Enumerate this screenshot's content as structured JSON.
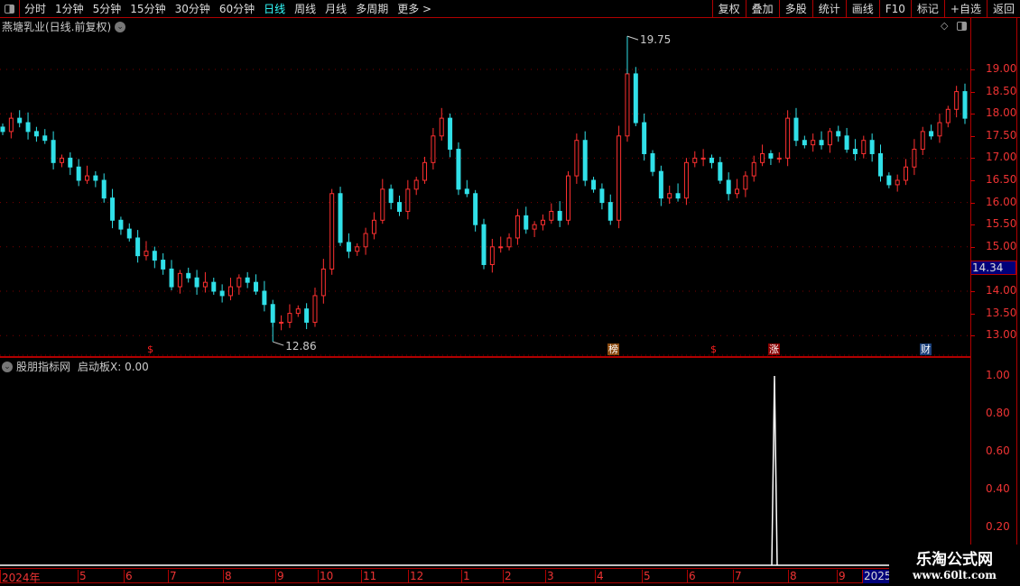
{
  "toolbar": {
    "periods": [
      "分时",
      "1分钟",
      "5分钟",
      "15分钟",
      "30分钟",
      "60分钟",
      "日线",
      "周线",
      "月线",
      "多周期",
      "更多 >"
    ],
    "active_period": "日线",
    "buttons": [
      "复权",
      "叠加",
      "多股",
      "统计",
      "画线",
      "F10",
      "标记",
      "+自选",
      "返回"
    ]
  },
  "title": "燕塘乳业(日线.前复权)",
  "price_axis": {
    "labels": [
      "19.00",
      "18.50",
      "18.00",
      "17.50",
      "17.00",
      "16.50",
      "16.00",
      "15.50",
      "15.00",
      "14.00",
      "13.50",
      "13.00"
    ],
    "current_price": "14.34"
  },
  "annotations": {
    "max_label": "19.75",
    "min_label": "12.86"
  },
  "event_tags": [
    {
      "text": "$",
      "color": "#ff2020",
      "bg": ""
    },
    {
      "text": "榜",
      "color": "#fff",
      "bg": "#8a4a10"
    },
    {
      "text": "$",
      "color": "#ff2020",
      "bg": ""
    },
    {
      "text": "涨",
      "color": "#fff",
      "bg": "#8a0000"
    },
    {
      "text": "财",
      "color": "#fff",
      "bg": "#1a3f7a"
    }
  ],
  "indicator": {
    "title": "股朋指标网",
    "name": "启动板X: 0.00",
    "axis_labels": [
      "1.00",
      "0.80",
      "0.60",
      "0.40",
      "0.20"
    ],
    "spike_value": 1.0
  },
  "time_axis": [
    "2024年",
    "5",
    "6",
    "7",
    "8",
    "9",
    "10",
    "11",
    "12",
    "1",
    "2",
    "3",
    "4",
    "5",
    "6",
    "7",
    "8",
    "9",
    "2025"
  ],
  "watermark": {
    "line1": "乐淘公式网",
    "line2": "www.60lt.com"
  },
  "colors": {
    "up": "#ff3030",
    "down": "#30e0e8",
    "axis": "#b00000",
    "accent": "#33ffff"
  },
  "chart_data": {
    "type": "candlestick",
    "ylim": [
      12.7,
      20.0
    ],
    "closes": [
      17.6,
      17.9,
      17.8,
      17.6,
      17.5,
      17.4,
      16.9,
      17.0,
      16.8,
      16.5,
      16.6,
      16.5,
      16.1,
      15.6,
      15.4,
      15.2,
      14.8,
      14.9,
      14.7,
      14.5,
      14.1,
      14.4,
      14.3,
      14.1,
      14.2,
      14.0,
      13.9,
      14.1,
      14.3,
      14.2,
      14.0,
      13.7,
      13.3,
      13.3,
      13.5,
      13.6,
      13.3,
      13.9,
      14.5,
      16.2,
      15.1,
      14.9,
      15.0,
      15.3,
      15.6,
      16.3,
      16.0,
      15.8,
      16.3,
      16.5,
      16.9,
      17.5,
      17.9,
      17.2,
      16.3,
      16.2,
      15.5,
      14.6,
      15.0,
      15.0,
      15.2,
      15.7,
      15.4,
      15.5,
      15.6,
      15.8,
      15.6,
      16.6,
      17.4,
      16.5,
      16.3,
      16.0,
      15.6,
      17.5,
      18.9,
      17.8,
      17.1,
      16.7,
      16.1,
      16.2,
      16.1,
      16.9,
      17.0,
      17.0,
      16.9,
      16.5,
      16.2,
      16.3,
      16.6,
      16.9,
      17.1,
      17.0,
      17.0,
      17.9,
      17.4,
      17.3,
      17.4,
      17.3,
      17.6,
      17.5,
      17.2,
      17.1,
      17.4,
      17.1,
      16.6,
      16.4,
      16.5,
      16.8,
      17.2,
      17.6,
      17.5,
      17.8,
      18.1,
      18.5,
      17.9
    ]
  }
}
